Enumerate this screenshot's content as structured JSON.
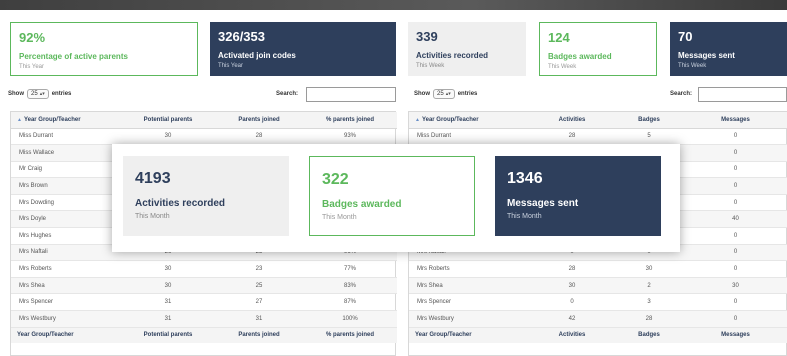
{
  "top_cards": [
    {
      "value": "92%",
      "label": "Percentage of active parents",
      "period": "This Year",
      "style": "white"
    },
    {
      "value": "326/353",
      "label": "Activated join codes",
      "period": "This Year",
      "style": "navy"
    },
    {
      "value": "339",
      "label": "Activities recorded",
      "period": "This Week",
      "style": "grey"
    },
    {
      "value": "124",
      "label": "Badges awarded",
      "period": "This Week",
      "style": "white"
    },
    {
      "value": "70",
      "label": "Messages sent",
      "period": "This Week",
      "style": "navy"
    }
  ],
  "controls": {
    "show_label": "Show",
    "entries_label": "entries",
    "entries_value": "25",
    "search_label": "Search:",
    "search_value": ""
  },
  "left_table": {
    "headers": [
      "Year Group/Teacher",
      "Potential parents",
      "Parents joined",
      "% parents joined"
    ],
    "rows": [
      [
        "Miss Durrant",
        "30",
        "28",
        "93%"
      ],
      [
        "Miss Wallace",
        "",
        "",
        ""
      ],
      [
        "Mr Craig",
        "",
        "",
        ""
      ],
      [
        "Mrs Brown",
        "",
        "",
        ""
      ],
      [
        "Mrs Dowding",
        "",
        "",
        ""
      ],
      [
        "Mrs Doyle",
        "",
        "",
        ""
      ],
      [
        "Mrs Hughes",
        "",
        "",
        ""
      ],
      [
        "Mrs Naftali",
        "26",
        "25",
        "96%"
      ],
      [
        "Mrs Roberts",
        "30",
        "23",
        "77%"
      ],
      [
        "Mrs Shea",
        "30",
        "25",
        "83%"
      ],
      [
        "Mrs Spencer",
        "31",
        "27",
        "87%"
      ],
      [
        "Mrs Westbury",
        "31",
        "31",
        "100%"
      ]
    ]
  },
  "right_table": {
    "headers": [
      "Year Group/Teacher",
      "Activities",
      "Badges",
      "Messages"
    ],
    "rows": [
      [
        "Miss Durrant",
        "28",
        "5",
        "0"
      ],
      [
        "",
        "",
        "",
        "0"
      ],
      [
        "",
        "",
        "",
        "0"
      ],
      [
        "",
        "",
        "",
        "0"
      ],
      [
        "",
        "",
        "",
        "0"
      ],
      [
        "",
        "",
        "",
        "40"
      ],
      [
        "",
        "",
        "",
        "0"
      ],
      [
        "Mrs Naftali",
        "0",
        "0",
        "0"
      ],
      [
        "Mrs Roberts",
        "28",
        "30",
        "0"
      ],
      [
        "Mrs Shea",
        "30",
        "2",
        "30"
      ],
      [
        "Mrs Spencer",
        "0",
        "3",
        "0"
      ],
      [
        "Mrs Westbury",
        "42",
        "28",
        "0"
      ]
    ]
  },
  "overlay_cards": [
    {
      "value": "4193",
      "label": "Activities recorded",
      "period": "This Month",
      "style": "grey"
    },
    {
      "value": "322",
      "label": "Badges awarded",
      "period": "This Month",
      "style": "white"
    },
    {
      "value": "1346",
      "label": "Messages sent",
      "period": "This Month",
      "style": "navy"
    }
  ],
  "colors": {
    "navy": "#2e3f5c",
    "green": "#5cb85c",
    "grey_card": "#efefef"
  }
}
